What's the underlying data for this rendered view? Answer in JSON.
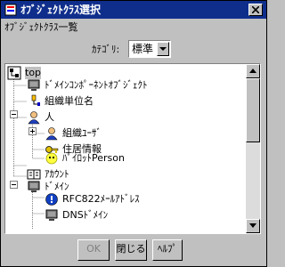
{
  "window": {
    "title": "ｵﾌﾞｼﾞｪｸﾄｸﾗｽ選択"
  },
  "header": {
    "section_label": "ｵﾌﾞｼﾞｪｸﾄｸﾗｽ一覧",
    "category_label": "ｶﾃｺﾞﾘ:",
    "category_value": "標準"
  },
  "tree": {
    "nodes": [
      {
        "label": "top",
        "icon": "tree-root-icon",
        "selected": true
      },
      {
        "label": "ﾄﾞﾒｲﾝｺﾝﾎﾟｰﾈﾝﾄｵﾌﾞｼﾞｪｸﾄ",
        "icon": "computer-icon"
      },
      {
        "label": "組織単位名",
        "icon": "org-unit-icon"
      },
      {
        "label": "人",
        "icon": "person-icon"
      },
      {
        "label": "組織ﾕｰｻﾞ",
        "icon": "person-icon"
      },
      {
        "label": "住居情報",
        "icon": "key-icon"
      },
      {
        "label": "ﾊﾟｲﾛｯﾄPerson",
        "icon": "pilot-icon"
      },
      {
        "label": "ｱｶｳﾝﾄ",
        "icon": "account-icon"
      },
      {
        "label": "ﾄﾞﾒｲﾝ",
        "icon": "computer-icon"
      },
      {
        "label": "RFC822ﾒｰﾙｱﾄﾞﾚｽ",
        "icon": "info-icon"
      },
      {
        "label": "DNSﾄﾞﾒｲﾝ",
        "icon": "computer-icon"
      }
    ]
  },
  "buttons": {
    "ok": "OK",
    "close": "閉じる",
    "help": "ﾍﾙﾌﾟ"
  },
  "colors": {
    "titlebar": "#0f2e8c",
    "face": "#c0c0c0"
  }
}
